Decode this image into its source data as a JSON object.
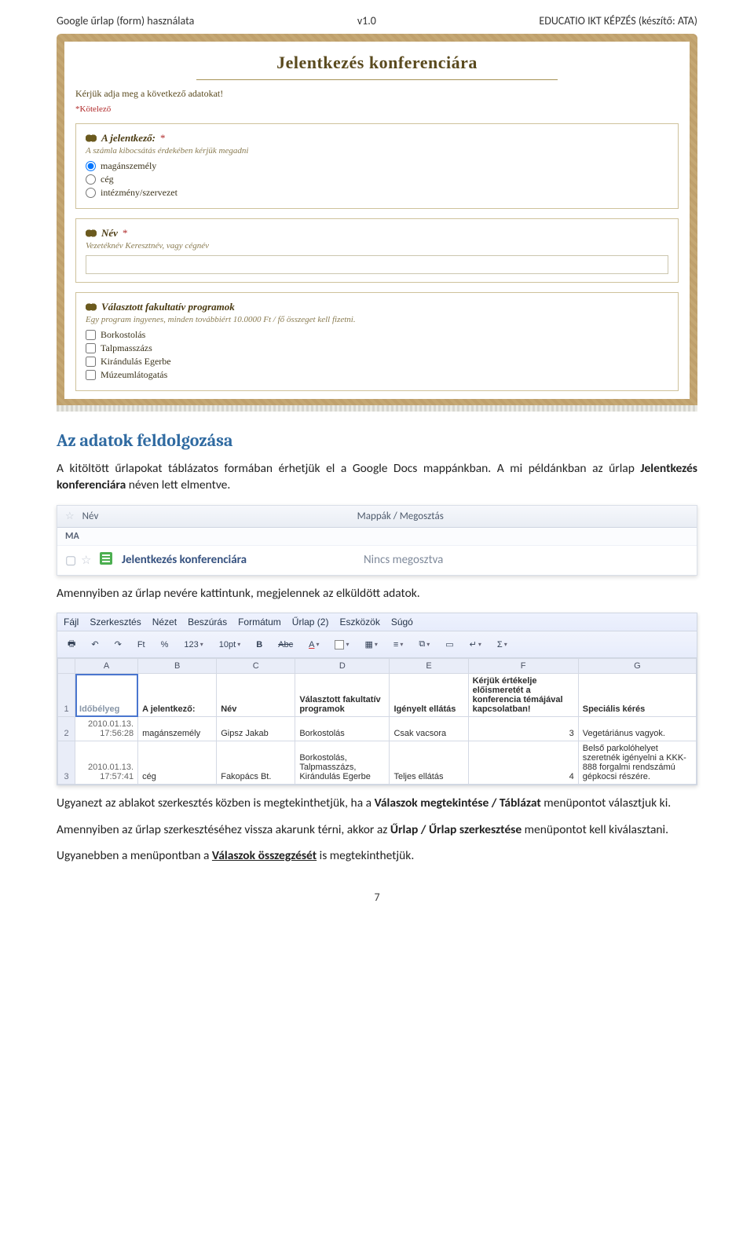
{
  "header": {
    "left": "Google űrlap  (form) használata",
    "mid": "v1.0",
    "right": "EDUCATIO IKT KÉPZÉS (készítő: ATA)"
  },
  "form": {
    "title": "Jelentkezés konferenciára",
    "intro": "Kérjük adja meg a következő adatokat!",
    "required": "*Kötelező",
    "q1": {
      "label": "A jelentkező:",
      "star": "*",
      "hint": "A számla kibocsátás érdekében kérjük megadni",
      "options": [
        "magánszemély",
        "cég",
        "intézmény/szervezet"
      ]
    },
    "q2": {
      "label": "Név",
      "star": "*",
      "hint": "Vezetéknév Keresztnév, vagy cégnév"
    },
    "q3": {
      "label": "Választott fakultatív programok",
      "hint": "Egy program ingyenes, minden továbbiért 10.0000 Ft / fő összeget kell fizetni.",
      "options": [
        "Borkostolás",
        "Talpmasszázs",
        "Kirándulás Egerbe",
        "Múzeumlátogatás"
      ]
    }
  },
  "sectionTitle": "Az adatok feldolgozása",
  "para1_a": "A kitöltött űrlapokat táblázatos formában érhetjük el a Google Docs mappánkban. A mi példánkban az űrlap ",
  "para1_b": "Jelentkezés konferenciára",
  "para1_c": " néven lett elmentve.",
  "docs": {
    "colName": "Név",
    "colShare": "Mappák / Megosztás",
    "group": "MA",
    "row": {
      "name": "Jelentkezés konferenciára",
      "share": "Nincs megosztva"
    }
  },
  "para2": "Amennyiben az űrlap nevére kattintunk, megjelennek az elküldött adatok.",
  "ss": {
    "menu": [
      "Fájl",
      "Szerkesztés",
      "Nézet",
      "Beszúrás",
      "Formátum",
      "Űrlap (2)",
      "Eszközök",
      "Súgó"
    ],
    "tools": {
      "ft": "Ft",
      "pct": "%",
      "zoom": "123",
      "font": "10pt",
      "sigma": "Σ"
    },
    "cols": [
      "A",
      "B",
      "C",
      "D",
      "E",
      "F",
      "G"
    ],
    "head": [
      "Időbélyeg",
      "A jelentkező:",
      "Név",
      "Választott fakultatív programok",
      "Igényelt ellátás",
      "Kérjük értékelje előismeretét a konferencia témájával kapcsolatban!",
      "Speciális kérés"
    ],
    "rows": [
      {
        "n": "2",
        "ts": "2010.01.13. 17:56:28",
        "a": "magánszemély",
        "b": "Gipsz Jakab",
        "c": "Borkostolás",
        "d": "Csak vacsora",
        "e": "3",
        "f": "Vegetáriánus vagyok."
      },
      {
        "n": "3",
        "ts": "2010.01.13. 17:57:41",
        "a": "cég",
        "b": "Fakopács Bt.",
        "c": "Borkostolás, Talpmasszázs, Kirándulás Egerbe",
        "d": "Teljes ellátás",
        "e": "4",
        "f": "Belső parkolóhelyet szeretnék igényelni a KKK-888 forgalmi rendszámú gépkocsi részére."
      }
    ]
  },
  "para3_a": "Ugyanezt az ablakot szerkesztés közben is megtekinthetjük, ha a ",
  "para3_b": "Válaszok megtekintése / Táblázat",
  "para3_c": " menüpontot választjuk ki.",
  "para4_a": "Amennyiben az űrlap szerkesztéséhez vissza akarunk térni, akkor az ",
  "para4_b": "Űrlap / Űrlap szerkesztése",
  "para4_c": " menüpontot kell kiválasztani.",
  "para5_a": "Ugyanebben a menüpontban a ",
  "para5_b": "Válaszok összegzését",
  "para5_c": " is megtekinthetjük.",
  "pageNum": "7"
}
